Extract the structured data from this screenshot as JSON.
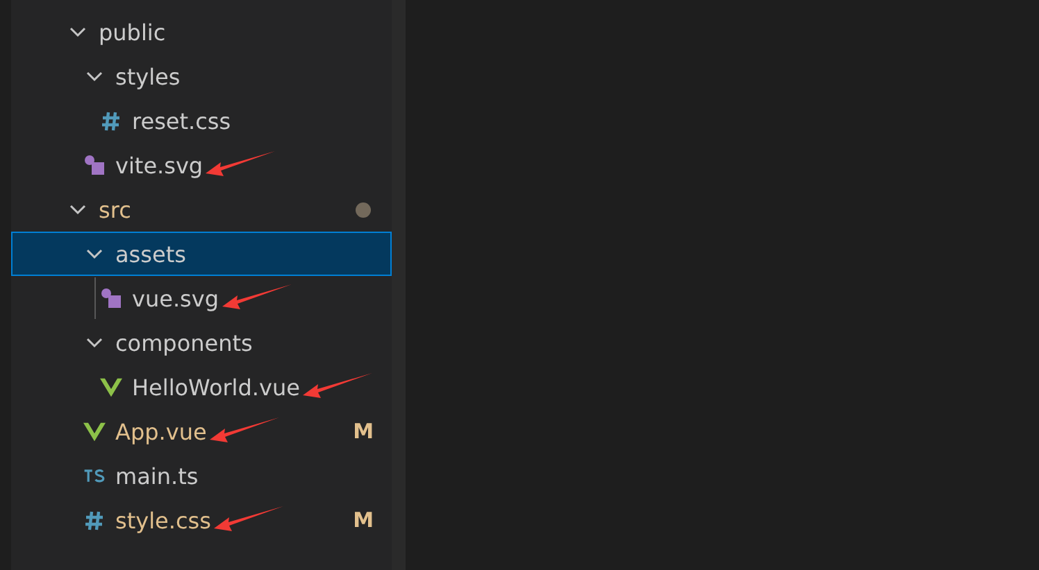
{
  "explorer": {
    "tree": [
      {
        "kind": "folder",
        "name": "public",
        "expanded": true,
        "selected": false,
        "modified": false,
        "has_changes": false,
        "arrow": false,
        "children": [
          {
            "kind": "folder",
            "name": "styles",
            "expanded": true,
            "selected": false,
            "modified": false,
            "has_changes": false,
            "arrow": false,
            "children": [
              {
                "kind": "css_file",
                "name": "reset.css",
                "selected": false,
                "modified": false,
                "arrow": false
              }
            ]
          },
          {
            "kind": "svg_file",
            "name": "vite.svg",
            "selected": false,
            "modified": false,
            "arrow": true
          }
        ]
      },
      {
        "kind": "folder",
        "name": "src",
        "expanded": true,
        "selected": false,
        "modified": true,
        "has_changes": true,
        "arrow": false,
        "children": [
          {
            "kind": "folder",
            "name": "assets",
            "expanded": true,
            "selected": true,
            "modified": false,
            "has_changes": false,
            "arrow": false,
            "children": [
              {
                "kind": "svg_file",
                "name": "vue.svg",
                "selected": false,
                "modified": false,
                "arrow": true
              }
            ]
          },
          {
            "kind": "folder",
            "name": "components",
            "expanded": true,
            "selected": false,
            "modified": false,
            "has_changes": false,
            "arrow": false,
            "children": [
              {
                "kind": "vue_file",
                "name": "HelloWorld.vue",
                "selected": false,
                "modified": false,
                "arrow": true
              }
            ]
          },
          {
            "kind": "vue_file",
            "name": "App.vue",
            "selected": false,
            "modified": true,
            "decoration": "M",
            "arrow": true
          },
          {
            "kind": "ts_file",
            "name": "main.ts",
            "selected": false,
            "modified": false,
            "arrow": false
          },
          {
            "kind": "css_file",
            "name": "style.css",
            "selected": false,
            "modified": true,
            "decoration": "M",
            "arrow": true
          }
        ]
      }
    ]
  }
}
